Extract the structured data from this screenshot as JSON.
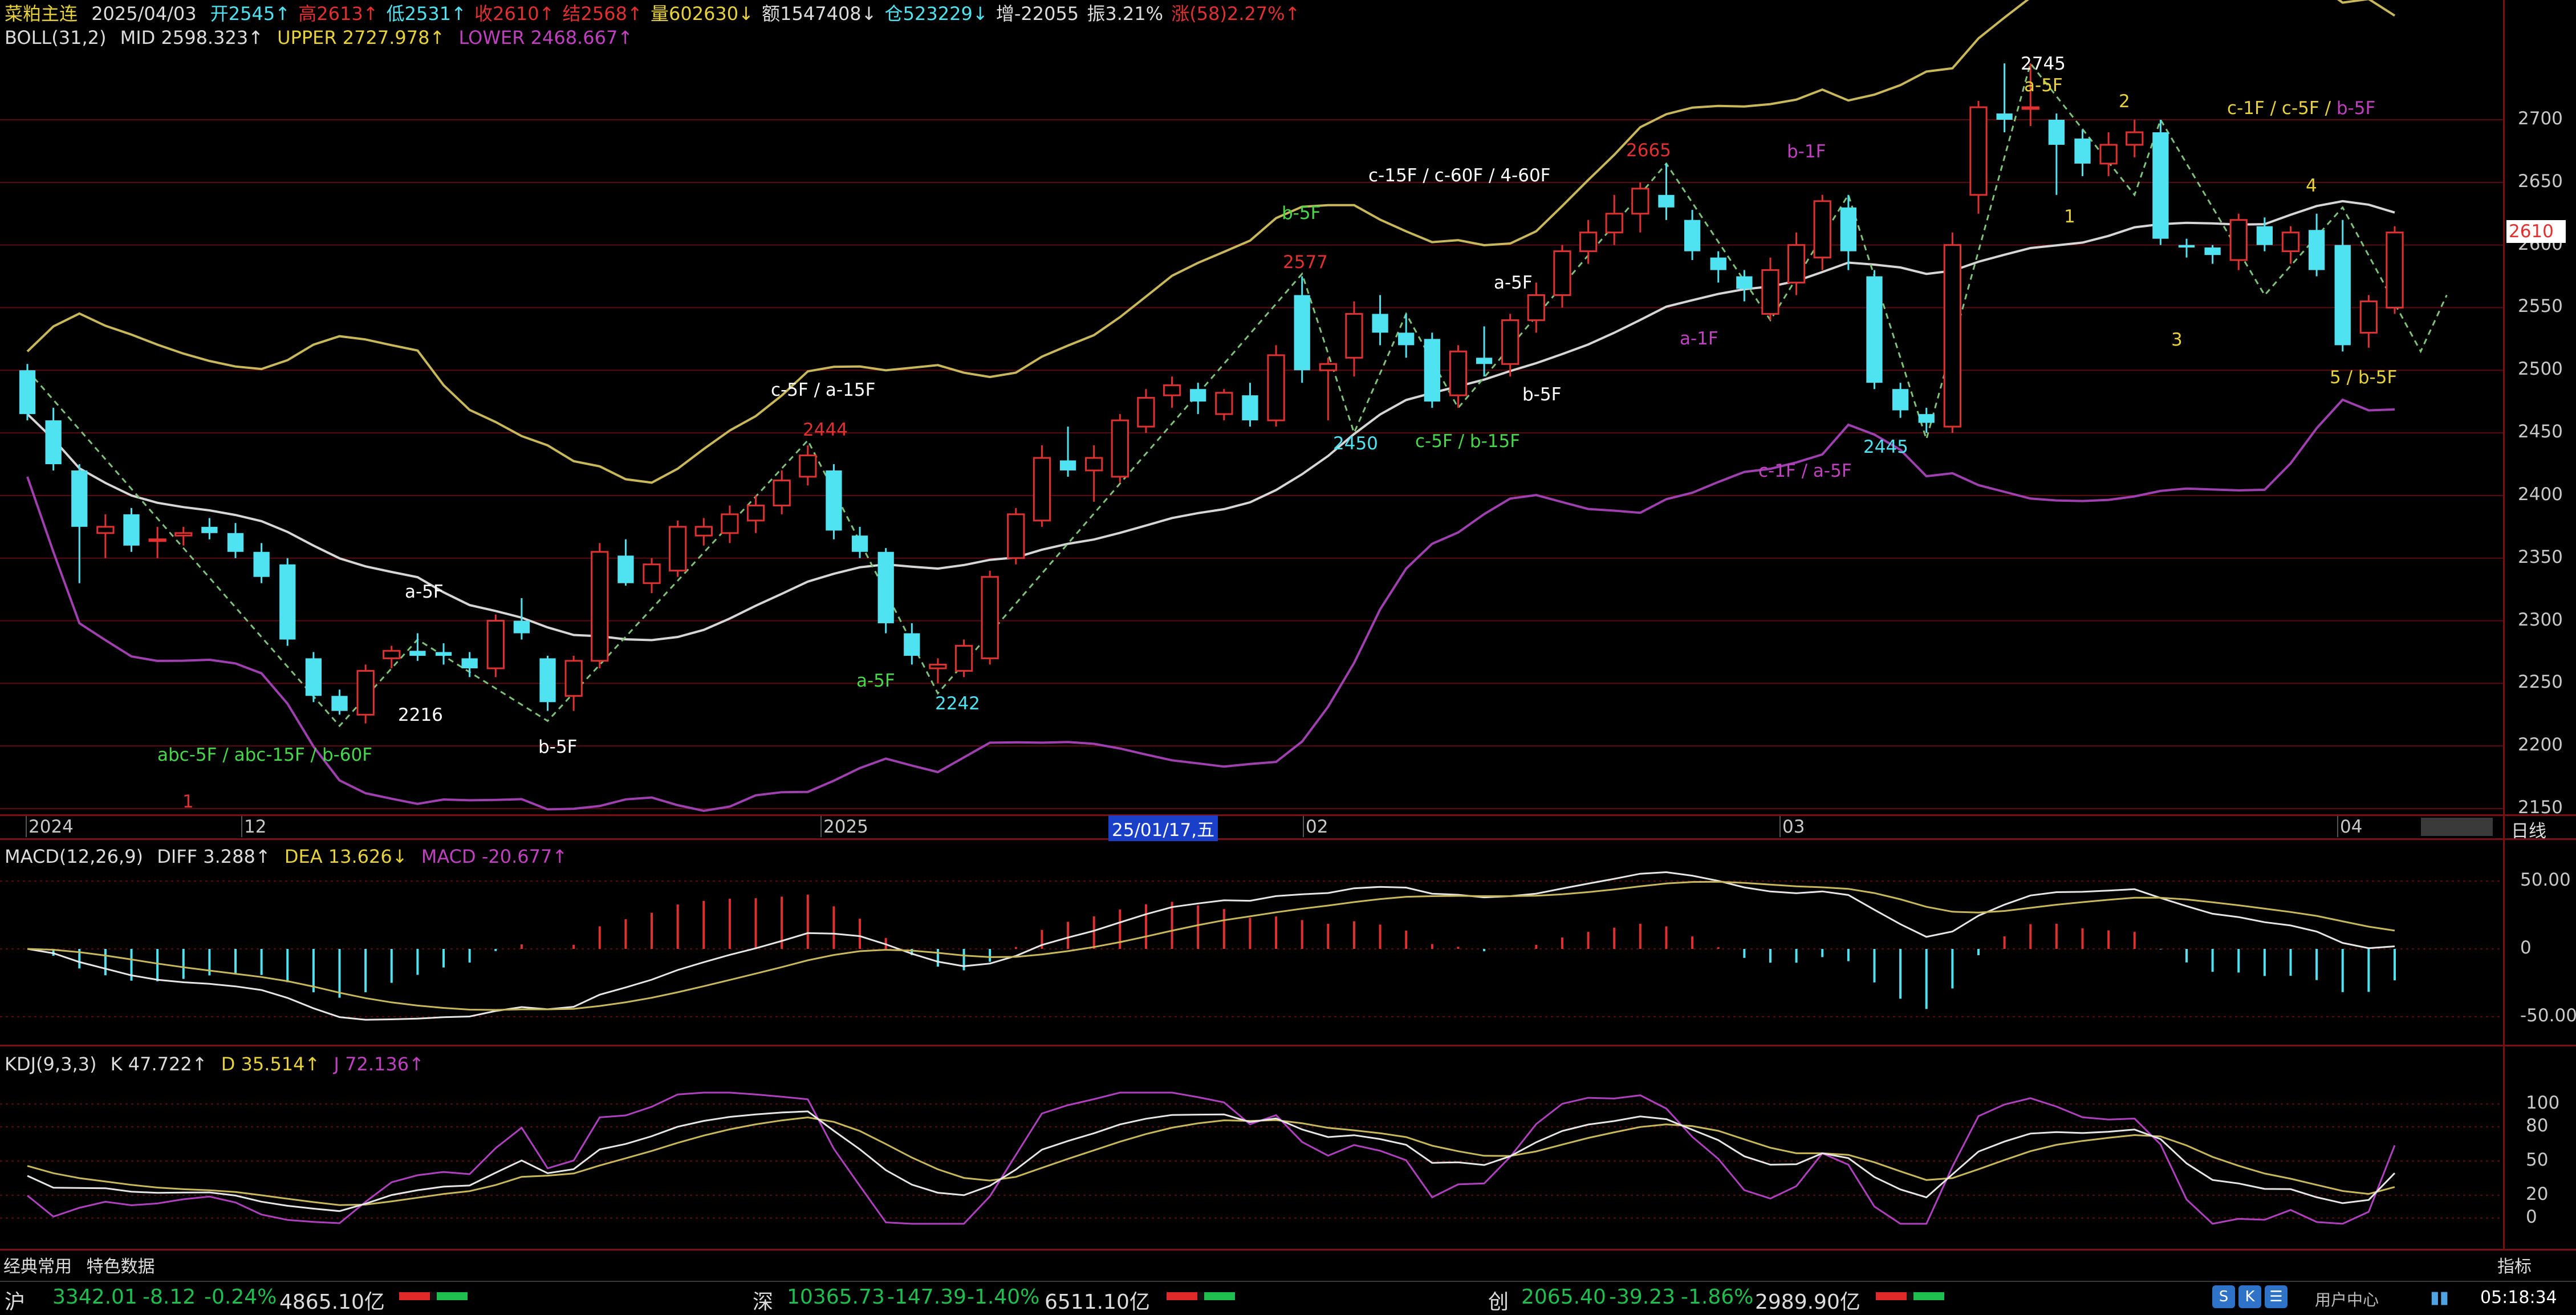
{
  "header": {
    "symbol": "菜粕主连",
    "date": "2025/04/03",
    "open": "开2545↑",
    "high": "高2613↑",
    "low": "低2531↑",
    "close": "收2610↑",
    "settle": "结2568↑",
    "volume": "量602630↓",
    "amount": "额1547408↓",
    "oi": "仓523229↓",
    "oi_change": "增-22055",
    "amplitude": "振3.21%",
    "change": "涨(58)2.27%↑"
  },
  "boll": {
    "name": "BOLL(31,2)",
    "mid": "MID 2598.323↑",
    "upper": "UPPER 2727.978↑",
    "lower": "LOWER 2468.667↑"
  },
  "macd": {
    "name": "MACD(12,26,9)",
    "diff": "DIFF 3.288↑",
    "dea": "DEA 13.626↓",
    "macd": "MACD -20.677↑"
  },
  "kdj": {
    "name": "KDJ(9,3,3)",
    "k": "K 47.722↑",
    "d": "D 35.514↑",
    "j": "J 72.136↑"
  },
  "price_axis": [
    "2700",
    "2650",
    "2600",
    "2550",
    "2500",
    "2450",
    "2400",
    "2350",
    "2300",
    "2250",
    "2200",
    "2150"
  ],
  "current_price": "2610",
  "macd_axis": [
    "50.00",
    "0",
    "-50.00"
  ],
  "kdj_axis": [
    "100",
    "80",
    "50",
    "20",
    "0"
  ],
  "date_axis": {
    "d2024": "2024",
    "d12": "12",
    "d2025": "2025",
    "cursor": "25/01/17,五",
    "d02": "02",
    "d03": "03",
    "d04": "04",
    "period": "日线",
    "marker": "1"
  },
  "annotations": {
    "a5f_1": "a-5F",
    "p2216": "2216",
    "b5f_1": "b-5F",
    "abc": "abc-5F / abc-15F / b-60F",
    "c5f_a15f": "c-5F / a-15F",
    "p2444": "2444",
    "a5f_2": "a-5F",
    "p2242": "2242",
    "b5f_2": "b-5F",
    "p2577": "2577",
    "p2450": "2450",
    "c15f": "c-15F / c-60F / 4-60F",
    "a5f_3": "a-5F",
    "b5f_3": "b-5F",
    "c5f_b15f": "c-5F / b-15F",
    "p2665": "2665",
    "a1f": "a-1F",
    "b1f": "b-1F",
    "c1f_a5f": "c-1F / a-5F",
    "p2445": "2445",
    "p2745": "2745",
    "a5f_4": "a-5F",
    "w1": "1",
    "w2": "2",
    "w3": "3",
    "w4": "4",
    "c1f_c5f": "c-1F / c-5F / ",
    "b5f_4": "b-5F",
    "w5": "5 / b-5F"
  },
  "tabs": [
    "经典常用",
    "特色数据"
  ],
  "indicator_label": "指标",
  "status": {
    "sh_label": "沪",
    "sh_value": "3342.01",
    "sh_change": "-8.12",
    "sh_pct": "-0.24%",
    "sh_amount": "4865.10亿",
    "sz_label": "深",
    "sz_value": "10365.73",
    "sz_change": "-147.39",
    "sz_pct": "-1.40%",
    "sz_amount": "6511.10亿",
    "cy_label": "创",
    "cy_value": "2065.40",
    "cy_change": "-39.23",
    "cy_pct": "-1.86%",
    "cy_amount": "2989.90亿",
    "user_center": "用户中心",
    "time": "05:18:34"
  },
  "colors": {
    "up": "#e03030",
    "down": "#4fe3f2",
    "boll_mid": "#d6d6d6",
    "boll_upper": "#c8b85a",
    "boll_lower": "#a040b0",
    "grid": "#5a0b10",
    "k": "#e6e6e6",
    "d": "#c8b85a",
    "j": "#b040c0"
  },
  "chart_data": {
    "type": "candlestick",
    "title": "菜粕主连 日线",
    "ylim": [
      2150,
      2760
    ],
    "series": [
      {
        "name": "菜粕主连",
        "ohlc": [
          [
            2500,
            2505,
            2460,
            2465
          ],
          [
            2460,
            2470,
            2420,
            2425
          ],
          [
            2420,
            2425,
            2330,
            2375
          ],
          [
            2370,
            2385,
            2350,
            2375
          ],
          [
            2385,
            2390,
            2355,
            2360
          ],
          [
            2365,
            2375,
            2350,
            2365
          ],
          [
            2368,
            2375,
            2360,
            2370
          ],
          [
            2375,
            2382,
            2365,
            2370
          ],
          [
            2370,
            2378,
            2350,
            2355
          ],
          [
            2355,
            2362,
            2330,
            2335
          ],
          [
            2345,
            2350,
            2280,
            2285
          ],
          [
            2270,
            2275,
            2235,
            2240
          ],
          [
            2240,
            2245,
            2225,
            2228
          ],
          [
            2225,
            2265,
            2218,
            2260
          ],
          [
            2270,
            2280,
            2262,
            2276
          ],
          [
            2276,
            2290,
            2268,
            2272
          ],
          [
            2275,
            2282,
            2265,
            2272
          ],
          [
            2270,
            2275,
            2255,
            2262
          ],
          [
            2262,
            2305,
            2255,
            2300
          ],
          [
            2300,
            2318,
            2285,
            2290
          ],
          [
            2270,
            2272,
            2228,
            2235
          ],
          [
            2240,
            2272,
            2228,
            2268
          ],
          [
            2268,
            2362,
            2262,
            2355
          ],
          [
            2352,
            2365,
            2328,
            2330
          ],
          [
            2330,
            2350,
            2322,
            2345
          ],
          [
            2340,
            2380,
            2335,
            2375
          ],
          [
            2368,
            2382,
            2360,
            2375
          ],
          [
            2370,
            2392,
            2362,
            2385
          ],
          [
            2380,
            2400,
            2370,
            2392
          ],
          [
            2392,
            2420,
            2385,
            2412
          ],
          [
            2415,
            2440,
            2408,
            2432
          ],
          [
            2420,
            2425,
            2365,
            2372
          ],
          [
            2368,
            2375,
            2350,
            2355
          ],
          [
            2355,
            2358,
            2290,
            2298
          ],
          [
            2290,
            2298,
            2265,
            2272
          ],
          [
            2262,
            2270,
            2250,
            2265
          ],
          [
            2260,
            2285,
            2255,
            2280
          ],
          [
            2270,
            2340,
            2265,
            2335
          ],
          [
            2350,
            2390,
            2345,
            2385
          ],
          [
            2380,
            2440,
            2375,
            2430
          ],
          [
            2428,
            2455,
            2415,
            2420
          ],
          [
            2420,
            2440,
            2395,
            2430
          ],
          [
            2415,
            2465,
            2410,
            2460
          ],
          [
            2455,
            2485,
            2450,
            2478
          ],
          [
            2480,
            2495,
            2470,
            2488
          ],
          [
            2485,
            2490,
            2465,
            2475
          ],
          [
            2465,
            2485,
            2460,
            2482
          ],
          [
            2480,
            2490,
            2455,
            2460
          ],
          [
            2460,
            2520,
            2455,
            2512
          ],
          [
            2560,
            2575,
            2490,
            2500
          ],
          [
            2500,
            2510,
            2460,
            2505
          ],
          [
            2510,
            2555,
            2495,
            2545
          ],
          [
            2545,
            2560,
            2520,
            2530
          ],
          [
            2530,
            2545,
            2510,
            2520
          ],
          [
            2525,
            2530,
            2470,
            2475
          ],
          [
            2480,
            2520,
            2470,
            2515
          ],
          [
            2510,
            2535,
            2495,
            2505
          ],
          [
            2505,
            2545,
            2495,
            2540
          ],
          [
            2540,
            2570,
            2530,
            2560
          ],
          [
            2560,
            2600,
            2550,
            2595
          ],
          [
            2595,
            2620,
            2585,
            2610
          ],
          [
            2610,
            2640,
            2600,
            2625
          ],
          [
            2625,
            2650,
            2610,
            2645
          ],
          [
            2640,
            2665,
            2620,
            2630
          ],
          [
            2620,
            2628,
            2588,
            2595
          ],
          [
            2590,
            2595,
            2570,
            2580
          ],
          [
            2575,
            2580,
            2555,
            2565
          ],
          [
            2545,
            2590,
            2540,
            2580
          ],
          [
            2570,
            2610,
            2560,
            2600
          ],
          [
            2590,
            2640,
            2580,
            2635
          ],
          [
            2630,
            2640,
            2580,
            2595
          ],
          [
            2575,
            2580,
            2485,
            2490
          ],
          [
            2485,
            2490,
            2462,
            2468
          ],
          [
            2465,
            2470,
            2450,
            2458
          ],
          [
            2455,
            2610,
            2450,
            2600
          ],
          [
            2640,
            2715,
            2625,
            2710
          ],
          [
            2705,
            2745,
            2690,
            2700
          ],
          [
            2710,
            2745,
            2695,
            2710
          ],
          [
            2700,
            2705,
            2640,
            2680
          ],
          [
            2685,
            2692,
            2655,
            2665
          ],
          [
            2665,
            2690,
            2655,
            2680
          ],
          [
            2680,
            2700,
            2670,
            2690
          ],
          [
            2690,
            2700,
            2600,
            2605
          ],
          [
            2600,
            2605,
            2590,
            2598
          ],
          [
            2598,
            2600,
            2585,
            2592
          ],
          [
            2588,
            2625,
            2580,
            2620
          ],
          [
            2615,
            2622,
            2595,
            2600
          ],
          [
            2595,
            2615,
            2585,
            2610
          ],
          [
            2612,
            2625,
            2575,
            2580
          ],
          [
            2600,
            2620,
            2515,
            2520
          ],
          [
            2530,
            2560,
            2518,
            2555
          ],
          [
            2550,
            2615,
            2545,
            2610
          ]
        ]
      },
      {
        "name": "MID"
      },
      {
        "name": "UPPER"
      },
      {
        "name": "LOWER"
      }
    ]
  }
}
